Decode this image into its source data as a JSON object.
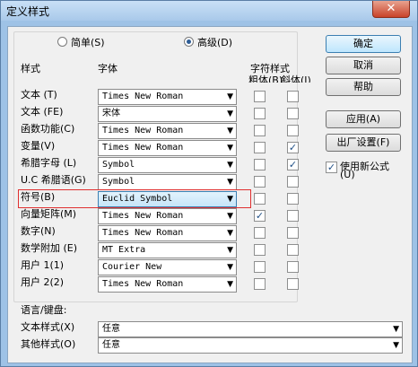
{
  "window": {
    "title": "定义样式",
    "close": "✕"
  },
  "mode": {
    "simple": "简单(S)",
    "advanced": "高级(D)"
  },
  "headers": {
    "style": "样式",
    "font": "字体",
    "char_style": "字符样式",
    "bold": "粗体(B)",
    "italic": "斜体(I)"
  },
  "rows": [
    {
      "label": "文本 (T)",
      "font": "Times New Roman",
      "bold": false,
      "italic": false
    },
    {
      "label": "文本 (FE)",
      "font": "宋体",
      "bold": false,
      "italic": false
    },
    {
      "label": "函数功能(C)",
      "font": "Times New Roman",
      "bold": false,
      "italic": false
    },
    {
      "label": "变量(V)",
      "font": "Times New Roman",
      "bold": false,
      "italic": true
    },
    {
      "label": "希腊字母 (L)",
      "font": "Symbol",
      "bold": false,
      "italic": true
    },
    {
      "label": "U.C 希腊语(G)",
      "font": "Symbol",
      "bold": false,
      "italic": false
    },
    {
      "label": "符号(B)",
      "font": "Euclid Symbol",
      "bold": false,
      "italic": false
    },
    {
      "label": "向量矩阵(M)",
      "font": "Times New Roman",
      "bold": true,
      "italic": false
    },
    {
      "label": "数字(N)",
      "font": "Times New Roman",
      "bold": false,
      "italic": false
    },
    {
      "label": "数学附加 (E)",
      "font": "MT Extra",
      "bold": false,
      "italic": false
    },
    {
      "label": "用户 1(1)",
      "font": "Courier New",
      "bold": false,
      "italic": false
    },
    {
      "label": "用户 2(2)",
      "font": "Times New Roman",
      "bold": false,
      "italic": false
    }
  ],
  "language": {
    "heading": "语言/键盘:",
    "text_style_label": "文本样式(X)",
    "text_style_value": "任意",
    "other_style_label": "其他样式(O)",
    "other_style_value": "任意"
  },
  "buttons": {
    "ok": "确定",
    "cancel": "取消",
    "help": "帮助",
    "apply": "应用(A)",
    "factory": "出厂设置(F)"
  },
  "use_new": {
    "label": "使用新公式",
    "label2": "(U)",
    "checked": true
  },
  "arrow": "▼",
  "check": "✓"
}
